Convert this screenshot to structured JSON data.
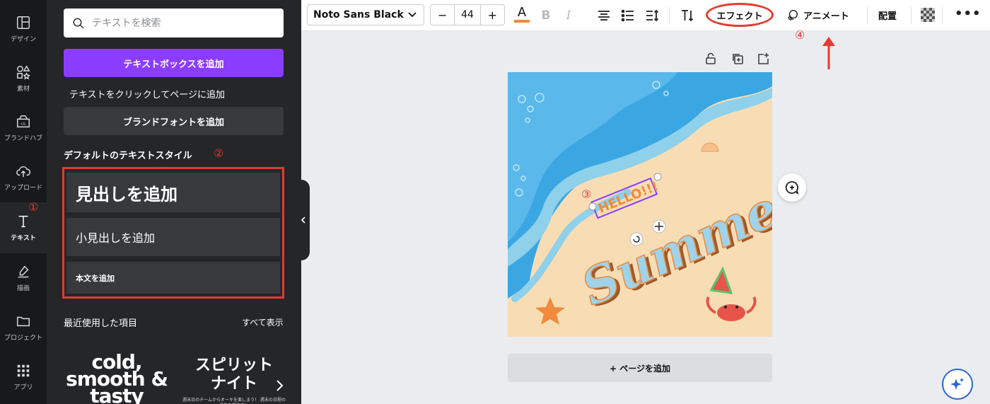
{
  "rail": {
    "items": [
      {
        "label": "デザイン",
        "icon": "layout-icon"
      },
      {
        "label": "素材",
        "icon": "shapes-icon"
      },
      {
        "label": "ブランドハブ",
        "icon": "brand-icon"
      },
      {
        "label": "アップロード",
        "icon": "upload-icon"
      },
      {
        "label": "テキスト",
        "icon": "text-icon"
      },
      {
        "label": "描画",
        "icon": "draw-icon"
      },
      {
        "label": "プロジェクト",
        "icon": "folder-icon"
      },
      {
        "label": "アプリ",
        "icon": "apps-icon"
      }
    ],
    "active": "テキスト"
  },
  "panel": {
    "search_placeholder": "テキストを検索",
    "add_textbox": "テキストボックスを追加",
    "hint": "テキストをクリックしてページに追加",
    "brand_font": "ブランドフォントを追加",
    "default_styles_title": "デフォルトのテキストスタイル",
    "heading": "見出しを追加",
    "subheading": "小見出しを追加",
    "body": "本文を追加",
    "recent_title": "最近使用した項目",
    "see_all": "すべて表示",
    "recent_1": "cold, smooth & tasty",
    "recent_2_line1": "スピリット",
    "recent_2_line2": "ナイト",
    "recent_2_small": "週末日のチームからオーキを楽しまう！ 週末の日程の最新を掲載中！"
  },
  "annotations": {
    "n1": "①",
    "n2": "②",
    "n3": "③",
    "n4": "④",
    "color": "#e53935"
  },
  "toolbar": {
    "font": "Noto Sans Black",
    "size_minus": "−",
    "size": "44",
    "size_plus": "+",
    "color_letter": "A",
    "bold": "B",
    "italic": "I",
    "effects": "エフェクト",
    "animate": "アニメート",
    "position": "配置",
    "more": "•••",
    "text_color": "#f08a3c"
  },
  "canvas": {
    "hello": "HELLO!!!",
    "summer": "Summer",
    "add_page": "+ ページを追加"
  },
  "colors": {
    "accent": "#8b3dff",
    "highlight": "#e53a2f",
    "sea": "#5bb8ea",
    "sand": "#f8ddb4"
  }
}
